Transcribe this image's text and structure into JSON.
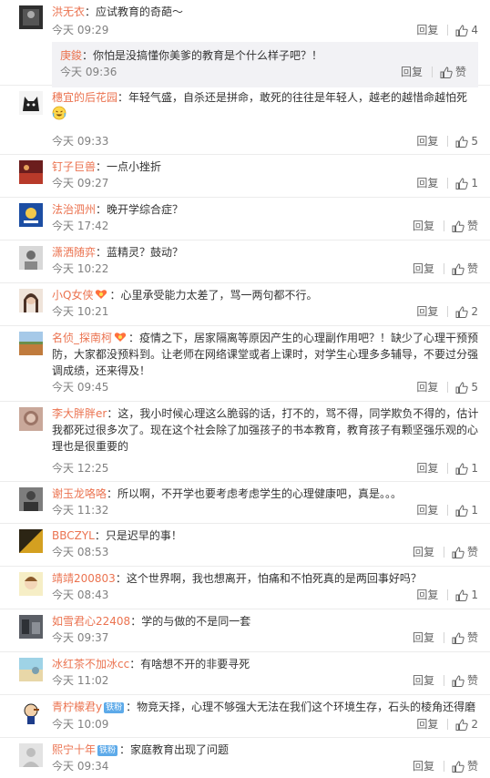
{
  "comments": [
    {
      "user": "洪无衣",
      "text": "：应试教育的奇葩～",
      "time": "今天 09:29",
      "reply": "回复",
      "likes": "4",
      "avatar": "dark-figure"
    },
    {
      "user": "穗宜的后花园",
      "text": "：年轻气盛，自杀还是拼命，敢死的往往是年轻人，越老的越惜命越怕死",
      "time": "今天 09:33",
      "reply": "回复",
      "likes": "5",
      "avatar": "black-cat",
      "emoji": "crying-laughing-emoji"
    },
    {
      "user": "钉子巨兽",
      "text": "：一点小挫折",
      "time": "今天 09:27",
      "reply": "回复",
      "likes": "1",
      "avatar": "red-scene"
    },
    {
      "user": "法治泗州",
      "text": "：晚开学综合症？",
      "time": "今天 17:42",
      "reply": "回复",
      "likes": "赞",
      "avatar": "blue-badge"
    },
    {
      "user": "潇洒随弈",
      "text": "：蓝精灵？鼓动？",
      "time": "今天 10:22",
      "reply": "回复",
      "likes": "赞",
      "avatar": "grey-portrait"
    },
    {
      "user": "小Q女侠",
      "text": "：心里承受能力太差了，骂一两句都不行。",
      "time": "今天 10:21",
      "reply": "回复",
      "likes": "2",
      "avatar": "girl-portrait",
      "fan_badge": true
    },
    {
      "user": "名侦_探南柯",
      "text": "：疫情之下，居家隔离等原因产生的心理副作用吧？！缺少了心理干预预防，大家都没预料到。让老师在网络课堂或者上课时，对学生心理多多辅导，不要过分强调成绩，还来得及！",
      "time": "今天 09:45",
      "reply": "回复",
      "likes": "5",
      "avatar": "landscape",
      "fan_badge": true
    },
    {
      "user": "李大胖胖er",
      "text": "：这，我小时候心理这么脆弱的话，打不的，骂不得，同学欺负不得的，估计我都死过很多次了。现在这个社会除了加强孩子的书本教育，教育孩子有颗坚强乐观的心理也是很重要的",
      "time": "今天 12:25",
      "reply": "回复",
      "likes": "1",
      "avatar": "blurry-face"
    },
    {
      "user": "谢玉龙咯咯",
      "text": "：所以啊，不开学也要考虑考虑学生的心理健康吧，真是。。。",
      "time": "今天 11:32",
      "reply": "回复",
      "likes": "1",
      "avatar": "grey-man"
    },
    {
      "user": "BBCZYL",
      "text": "：只是迟早的事！",
      "time": "今天 08:53",
      "reply": "回复",
      "likes": "赞",
      "avatar": "yellow-dark"
    },
    {
      "user": "靖靖200803",
      "text": "：这个世界啊，我也想离开，怕痛和不怕死真的是两回事好吗？",
      "time": "今天 08:43",
      "reply": "回复",
      "likes": "1",
      "avatar": "cartoon-girl"
    },
    {
      "user": "如雪君心22408",
      "text": "：学的与做的不是同一套",
      "time": "今天 09:37",
      "reply": "回复",
      "likes": "赞",
      "avatar": "street"
    },
    {
      "user": "冰红茶不加冰cc",
      "text": "：有啥想不开的非要寻死",
      "time": "今天 11:02",
      "reply": "回复",
      "likes": "赞",
      "avatar": "beach"
    },
    {
      "user": "青柠檬君y",
      "text": "：物竞天择，心理不够强大无法在我们这个环境生存，石头的棱角还得磨",
      "time": "今天 10:09",
      "reply": "回复",
      "likes": "2",
      "avatar": "popeye",
      "vip": "铁粉"
    },
    {
      "user": "熙宁十年",
      "text": "：家庭教育出现了问题",
      "time": "今天 09:34",
      "reply": "回复",
      "likes": "赞",
      "avatar": "default",
      "vip": "铁粉"
    }
  ],
  "nested_reply": {
    "user": "庚鋑",
    "text": "：你怕是没搞懂你美爹的教育是个什么样子吧？！",
    "time": "今天 09:36",
    "reply": "回复",
    "likes": "赞"
  },
  "colors": {
    "username": "#eb7350",
    "time": "#808080",
    "vip_badge": "#5daae9",
    "nested_bg": "#f2f2f5"
  }
}
